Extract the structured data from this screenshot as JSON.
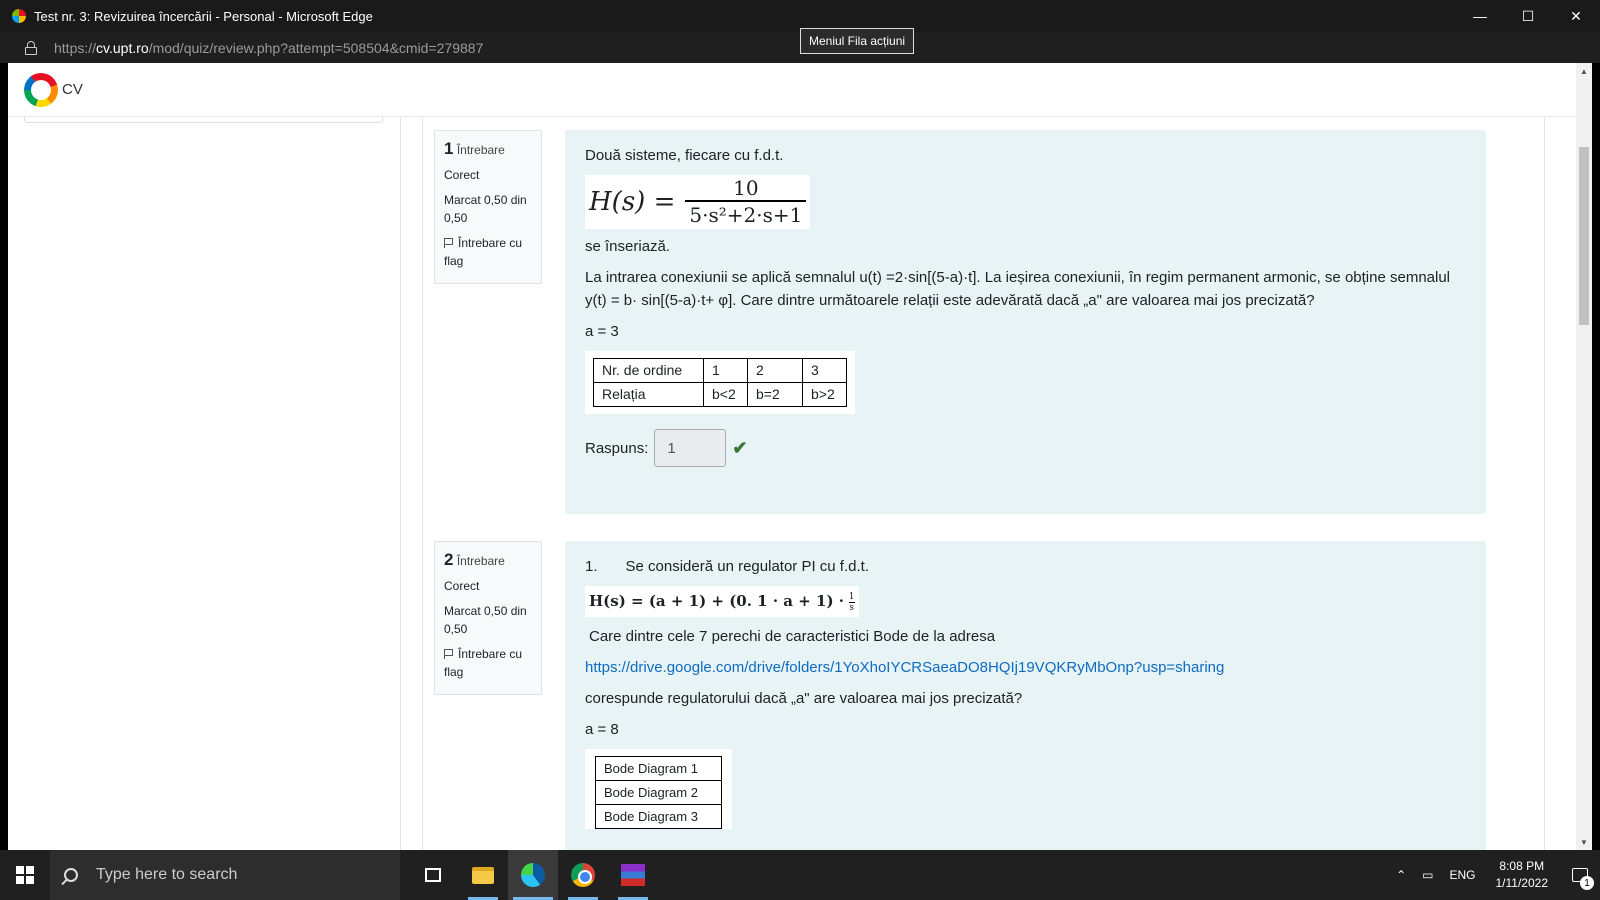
{
  "window": {
    "title": "Test nr. 3: Revizuirea încercării - Personal - Microsoft Edge",
    "minimize": "—",
    "maximize": "☐",
    "close": "✕"
  },
  "address": {
    "url_prefix": "https://",
    "url_host": "cv.upt.ro",
    "url_path": "/mod/quiz/review.php?attempt=508504&cmid=279887",
    "tooltip": "Meniul Fila acțiuni"
  },
  "site": {
    "logo_text": "CV"
  },
  "questions": [
    {
      "number": "1",
      "label": "Întrebare",
      "status": "Corect",
      "mark": "Marcat 0,50 din 0,50",
      "flag": "Întrebare cu flag",
      "intro": "Două sisteme, fiecare cu f.d.t.",
      "formula_lhs": "H(s) =",
      "formula_num": "10",
      "formula_den": "5·s²+2·s+1",
      "after_formula": "se înseriază.",
      "body": "La intrarea conexiunii se aplică semnalul u(t) =2·sin[(5-a)·t]. La ieșirea conexiunii, în regim permanent armonic, se obține semnalul y(t) = b· sin[(5-a)·t+ φ]. Care dintre următoarele relații este adevărată dacă „a\" are valoarea mai jos precizată?",
      "a_value": "a = 3",
      "table": {
        "row1": [
          "Nr. de ordine",
          "1",
          "2",
          "3"
        ],
        "row2": [
          "Relația",
          "b<2",
          "b=2",
          "b>2"
        ]
      },
      "answer_label": "Raspuns:",
      "answer_value": "1"
    },
    {
      "number": "2",
      "label": "Întrebare",
      "status": "Corect",
      "mark": "Marcat 0,50 din 0,50",
      "flag": "Întrebare cu flag",
      "list_no": "1.",
      "intro": "Se consideră un regulator PI cu f.d.t.",
      "formula": "H(s) = (a + 1) + (0. 1 · a + 1) ·",
      "formula_num": "1",
      "formula_den": "s",
      "question": "Care dintre cele 7 perechi de caracteristici Bode de la adresa",
      "link": "https://drive.google.com/drive/folders/1YoXhoIYCRSaeaDO8HQIj19VQKRyMbOnp?usp=sharing",
      "after_link": "corespunde regulatorului dacă „a\" are valoarea mai jos precizată?",
      "a_value": "a = 8",
      "bode": [
        "Bode Diagram 1",
        "Bode Diagram 2",
        "Bode Diagram 3"
      ]
    }
  ],
  "taskbar": {
    "search_placeholder": "Type here to search",
    "lang": "ENG",
    "time": "8:08 PM",
    "date": "1/11/2022",
    "notifications": "1"
  }
}
